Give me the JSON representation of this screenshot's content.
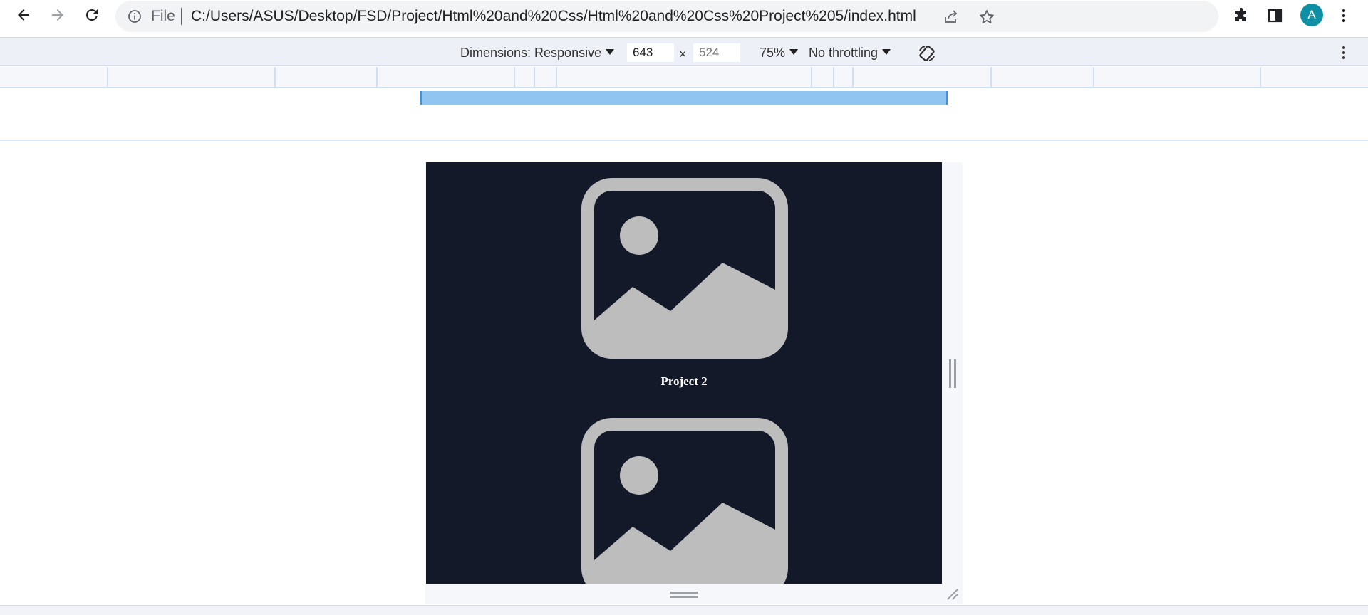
{
  "browser": {
    "scheme_label": "File",
    "url": "C:/Users/ASUS/Desktop/FSD/Project/Html%20and%20Css/Html%20and%20Css%20Project%205/index.html",
    "profile_initial": "A",
    "icons": {
      "back": "arrow-left-icon",
      "forward": "arrow-right-icon",
      "reload": "reload-icon",
      "info": "info-icon",
      "share": "share-icon",
      "bookmark": "star-icon",
      "extensions": "puzzle-icon",
      "side_panel": "side-panel-icon",
      "menu": "vertical-dots-icon"
    }
  },
  "device_toolbar": {
    "dimensions_label": "Dimensions: Responsive",
    "width_value": "643",
    "height_placeholder": "524",
    "times": "×",
    "zoom": "75%",
    "throttling": "No throttling"
  },
  "page": {
    "background": "#131928",
    "cards": [
      {
        "title": "Project 2",
        "icon": "image-placeholder-icon"
      },
      {
        "title": "",
        "icon": "image-placeholder-icon"
      }
    ]
  },
  "colors": {
    "placeholder_gray": "#bdbdbd",
    "ruler_highlight": "#90c5f2",
    "avatar": "#0e8fa3"
  }
}
